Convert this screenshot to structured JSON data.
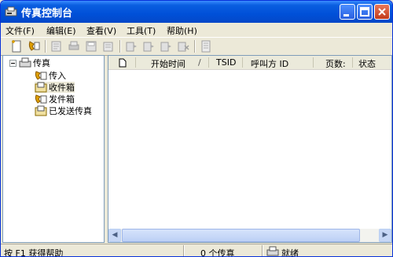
{
  "window": {
    "title": "传真控制台"
  },
  "menu": [
    "文件(F)",
    "编辑(E)",
    "查看(V)",
    "工具(T)",
    "帮助(H)"
  ],
  "toolbar": {
    "buttons": [
      "new-fax-icon",
      "receive-now-icon",
      "view-icon",
      "print-icon",
      "save-as-icon",
      "mail-icon",
      "pause-icon",
      "resume-icon",
      "restart-icon",
      "delete-icon",
      "properties-icon"
    ]
  },
  "tree": {
    "root": "传真",
    "items": [
      "传入",
      "收件箱",
      "发件箱",
      "已发送传真"
    ],
    "selected": "收件箱"
  },
  "list": {
    "columns": [
      "开始时间",
      "TSID",
      "呼叫方 ID",
      "页数:",
      "状态"
    ]
  },
  "status": {
    "help": "按 F1 获得帮助",
    "count": "0 个传真",
    "state": "就绪"
  }
}
